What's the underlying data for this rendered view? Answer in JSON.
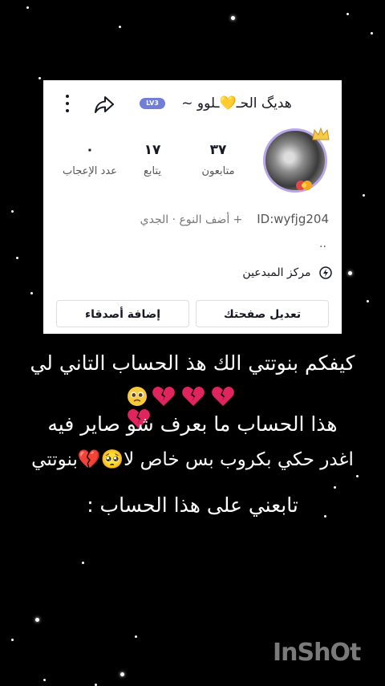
{
  "profile": {
    "username": "هديگ الحـ💛ـلوو ~",
    "level_badge": "LV3",
    "stats": [
      {
        "value": "٣٧",
        "label": "متابعون"
      },
      {
        "value": "١٧",
        "label": "يتابع"
      },
      {
        "value": "٠",
        "label": "عدد الإعجاب"
      }
    ],
    "user_id": "ID:wyfjg204",
    "add_gender": "+ أضف النوع",
    "separator": "·",
    "zodiac": "الجدي",
    "bio": "..",
    "creator_center": "مركز المبدعين",
    "edit_profile_button": "تعديل صفحتك",
    "add_friends_button": "إضافة أصدقاء"
  },
  "icons": {
    "more": "kebab-menu-icon",
    "share": "share-arrow-icon",
    "creator": "lightning-bolt-icon",
    "crown": "crown-icon"
  },
  "caption": {
    "line1": "كيفكم بنوتتي الك هذ الحساب التاني لي",
    "line3": "هذا الحساب ما بعرف شو صاير فيه",
    "line4": "اغدر حكي بكروب بس خاص لا🥺💔بنوتتي",
    "line5": "تابعني على هذا الحساب  :"
  },
  "emojis": [
    "broken-heart",
    "broken-heart",
    "broken-heart",
    "broken-heart",
    "pleading-face"
  ],
  "watermark": "InShOt",
  "colors": {
    "background": "#000000",
    "card": "#ffffff",
    "level_badge": "#6f7ed8",
    "broken_heart": "#e0245e",
    "watermark": "#7a7a7a"
  }
}
